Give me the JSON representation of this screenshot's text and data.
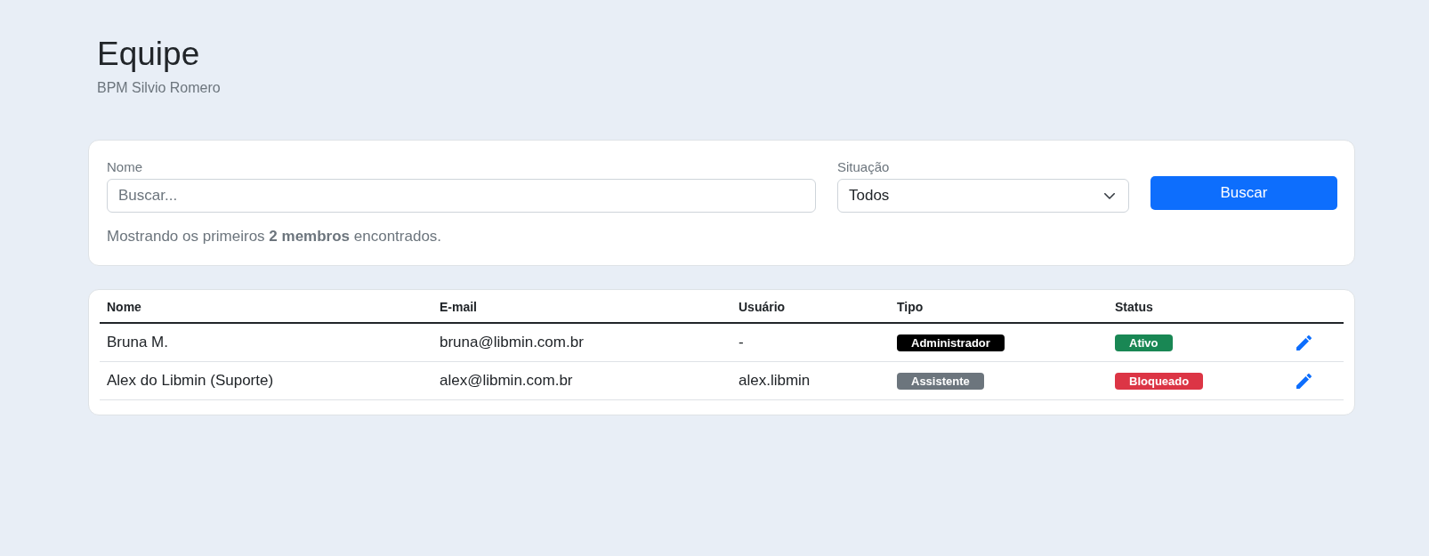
{
  "header": {
    "title": "Equipe",
    "subtitle": "BPM Silvio Romero"
  },
  "filters": {
    "name_field": {
      "label": "Nome",
      "placeholder": "Buscar..."
    },
    "status_field": {
      "label": "Situação",
      "value": "Todos"
    },
    "search_button": "Buscar",
    "summary": "Mostrando os primeiros **2 membros** encontrados."
  },
  "table": {
    "columns": [
      "Nome",
      "E-mail",
      "Usuário",
      "Tipo",
      "Status"
    ],
    "rows": [
      {
        "name": "Bruna M.",
        "email": "bruna@libmin.com.br",
        "username": "-",
        "type": {
          "label": "Administrador",
          "color": "#000000"
        },
        "status": {
          "label": "Ativo",
          "color": "#198754"
        }
      },
      {
        "name": "Alex do Libmin (Suporte)",
        "email": "alex@libmin.com.br",
        "username": "alex.libmin",
        "type": {
          "label": "Assistente",
          "color": "#6c757d"
        },
        "status": {
          "label": "Bloqueado",
          "color": "#dc3545"
        }
      }
    ]
  }
}
